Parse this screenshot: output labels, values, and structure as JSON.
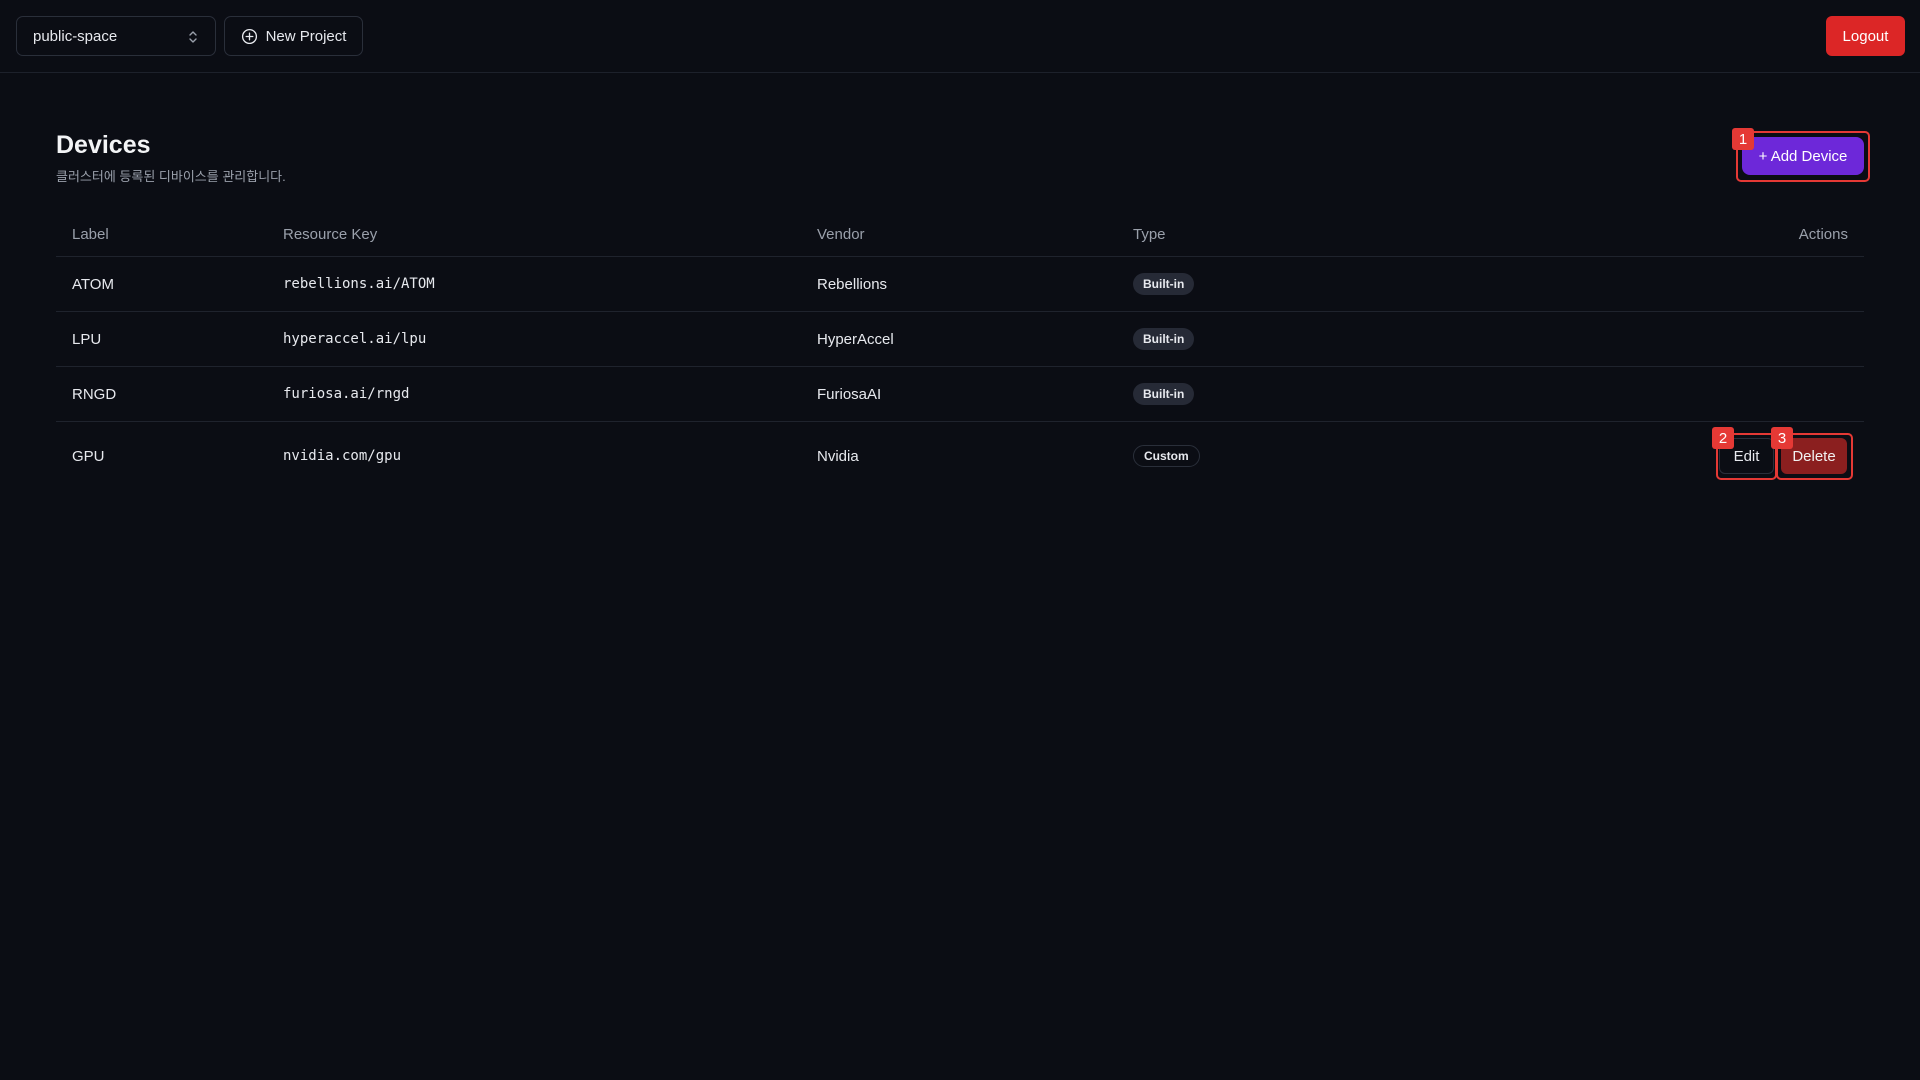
{
  "topbar": {
    "project_select": "public-space",
    "new_project_label": "New Project",
    "logout_label": "Logout"
  },
  "page": {
    "title": "Devices",
    "subtitle": "클러스터에 등록된 디바이스를 관리합니다.",
    "add_device_label": "+ Add Device"
  },
  "table": {
    "headers": [
      "Label",
      "Resource Key",
      "Vendor",
      "Type",
      "Actions"
    ],
    "rows": [
      {
        "label": "ATOM",
        "resource_key": "rebellions.ai/ATOM",
        "vendor": "Rebellions",
        "type": "Built-in"
      },
      {
        "label": "LPU",
        "resource_key": "hyperaccel.ai/lpu",
        "vendor": "HyperAccel",
        "type": "Built-in"
      },
      {
        "label": "RNGD",
        "resource_key": "furiosa.ai/rngd",
        "vendor": "FuriosaAI",
        "type": "Built-in"
      },
      {
        "label": "GPU",
        "resource_key": "nvidia.com/gpu",
        "vendor": "Nvidia",
        "type": "Custom",
        "edit_label": "Edit",
        "delete_label": "Delete"
      }
    ]
  },
  "annotations": [
    "1",
    "2",
    "3"
  ],
  "colors": {
    "background": "#0b0d14",
    "primary": "#6d28d9",
    "danger": "#dc2626",
    "danger_dark": "#8b1f1f",
    "highlight": "#e53935"
  },
  "icons": {
    "select": "chevron-up-down-icon",
    "new_project": "plus-circle-icon"
  }
}
